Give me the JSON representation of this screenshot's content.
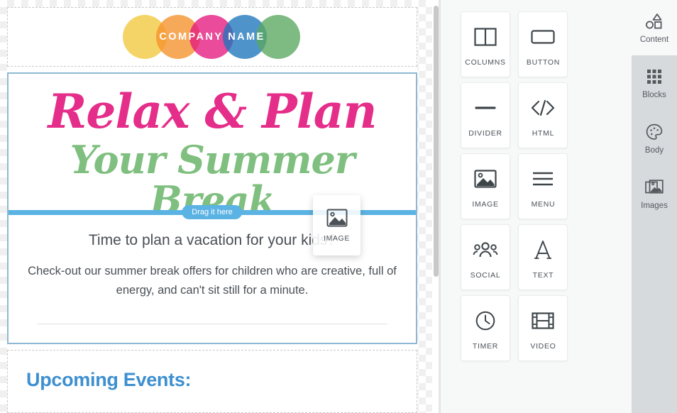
{
  "email": {
    "logo": {
      "name": "logo-block",
      "text_part1": "COMPANY",
      "text_part2": "NAME",
      "circle_colors": [
        "#f2c83c",
        "#f5912b",
        "#e4187e",
        "#1c76bc",
        "#5aa85f"
      ]
    },
    "hero": {
      "headline": "Relax & Plan",
      "headline_color": "#e52d8a",
      "subheadline": "Your Summer Break",
      "subheadline_color": "#7fbf7f",
      "lead": "Time to plan a vacation for your kids?",
      "paragraph": "Check-out our summer break offers for children who are creative, full of energy, and can't sit still for a minute."
    },
    "events": {
      "heading": "Upcoming Events:",
      "heading_color": "#3d8fd0"
    },
    "drop_indicator": {
      "label": "Drag it here",
      "color": "#5bb3e4"
    },
    "drag_ghost": {
      "label": "IMAGE",
      "icon": "image-icon"
    }
  },
  "panel": {
    "tiles": [
      {
        "label": "COLUMNS",
        "icon": "columns-icon"
      },
      {
        "label": "BUTTON",
        "icon": "button-icon"
      },
      {
        "label": "DIVIDER",
        "icon": "divider-icon"
      },
      {
        "label": "HTML",
        "icon": "code-icon"
      },
      {
        "label": "IMAGE",
        "icon": "image-icon"
      },
      {
        "label": "MENU",
        "icon": "menu-icon"
      },
      {
        "label": "SOCIAL",
        "icon": "people-icon"
      },
      {
        "label": "TEXT",
        "icon": "letter-a-icon"
      },
      {
        "label": "TIMER",
        "icon": "clock-icon"
      },
      {
        "label": "VIDEO",
        "icon": "film-icon"
      }
    ],
    "tabs": [
      {
        "label": "Content",
        "icon": "shapes-icon",
        "active": true
      },
      {
        "label": "Blocks",
        "icon": "grid-icon",
        "active": false
      },
      {
        "label": "Body",
        "icon": "palette-icon",
        "active": false
      },
      {
        "label": "Images",
        "icon": "photos-icon",
        "active": false
      }
    ]
  }
}
